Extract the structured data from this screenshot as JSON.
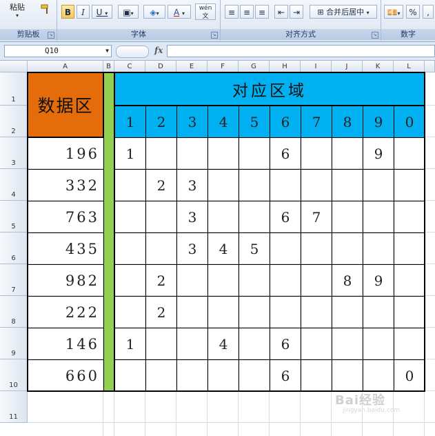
{
  "ribbon": {
    "clipboard": {
      "paste_label": "粘贴",
      "group_label": "剪贴板"
    },
    "font": {
      "bold": "B",
      "italic": "I",
      "underline": "U",
      "font_color": "A",
      "phonetic": "wén",
      "group_label": "字体"
    },
    "alignment": {
      "merge_center_label": "合并后居中",
      "group_label": "对齐方式"
    },
    "number": {
      "percent": "%",
      "comma": ",",
      "group_label": "数字"
    }
  },
  "formula_bar": {
    "name_box": "Q10",
    "fx": "fx",
    "formula": ""
  },
  "columns": [
    "A",
    "B",
    "C",
    "D",
    "E",
    "F",
    "G",
    "H",
    "I",
    "J",
    "K",
    "L"
  ],
  "rows": [
    "1",
    "2",
    "3",
    "4",
    "5",
    "6",
    "7",
    "8",
    "9",
    "10",
    "11"
  ],
  "table": {
    "data_header": "数据区",
    "region_header": "对应区域",
    "digit_headers": [
      "1",
      "2",
      "3",
      "4",
      "5",
      "6",
      "7",
      "8",
      "9",
      "0"
    ],
    "rows": [
      {
        "value": "196",
        "digits": [
          "1",
          "",
          "",
          "",
          "",
          "6",
          "",
          "",
          "9",
          ""
        ]
      },
      {
        "value": "332",
        "digits": [
          "",
          "2",
          "3",
          "",
          "",
          "",
          "",
          "",
          "",
          ""
        ]
      },
      {
        "value": "763",
        "digits": [
          "",
          "",
          "3",
          "",
          "",
          "6",
          "7",
          "",
          "",
          ""
        ]
      },
      {
        "value": "435",
        "digits": [
          "",
          "",
          "3",
          "4",
          "5",
          "",
          "",
          "",
          "",
          ""
        ]
      },
      {
        "value": "982",
        "digits": [
          "",
          "2",
          "",
          "",
          "",
          "",
          "",
          "8",
          "9",
          ""
        ]
      },
      {
        "value": "222",
        "digits": [
          "",
          "2",
          "",
          "",
          "",
          "",
          "",
          "",
          "",
          ""
        ]
      },
      {
        "value": "146",
        "digits": [
          "1",
          "",
          "",
          "4",
          "",
          "6",
          "",
          "",
          "",
          ""
        ]
      },
      {
        "value": "660",
        "digits": [
          "",
          "",
          "",
          "",
          "",
          "6",
          "",
          "",
          "",
          "0"
        ]
      }
    ]
  },
  "colors": {
    "orange": "#e46c0a",
    "blue": "#00b0f0",
    "green": "#92d050"
  },
  "watermark": {
    "text": "Bai经验",
    "sub": "jingyan.baidu.com"
  }
}
